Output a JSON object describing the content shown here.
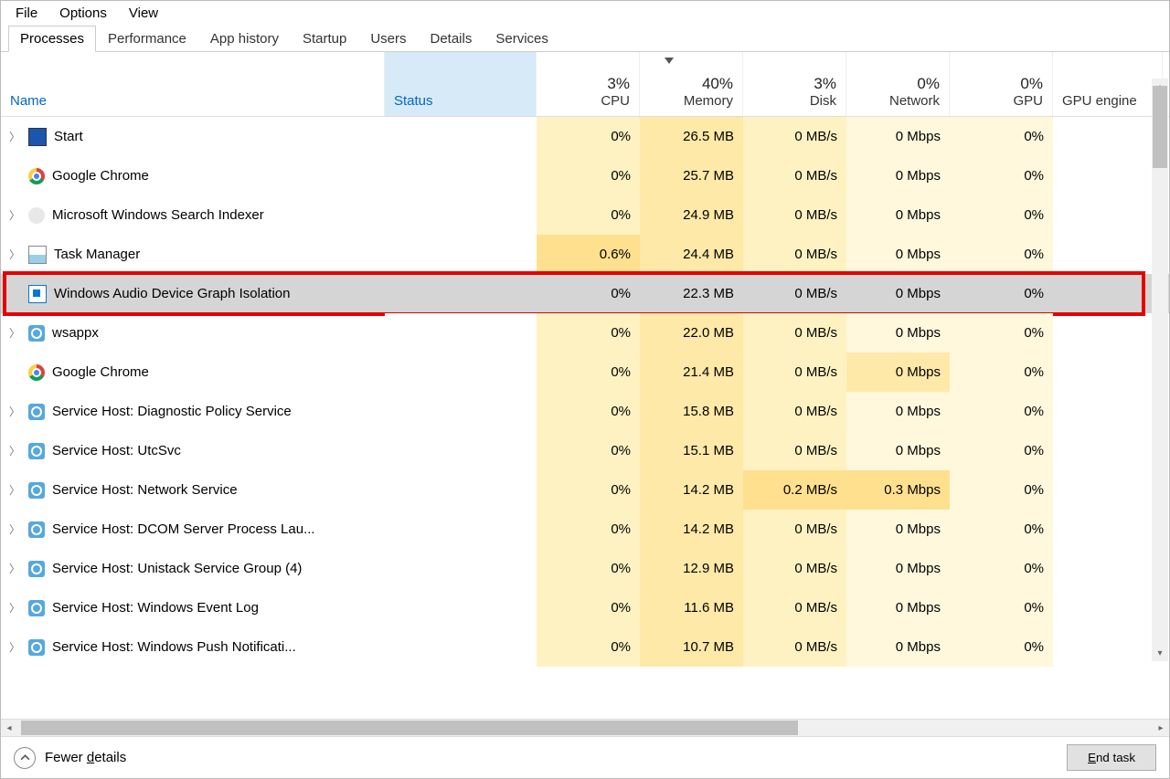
{
  "menu": {
    "file": "File",
    "options": "Options",
    "view": "View"
  },
  "tabs": [
    "Processes",
    "Performance",
    "App history",
    "Startup",
    "Users",
    "Details",
    "Services"
  ],
  "activeTab": "Processes",
  "columns": {
    "name": "Name",
    "status": "Status",
    "cpu": {
      "top": "3%",
      "bot": "CPU"
    },
    "mem": {
      "top": "40%",
      "bot": "Memory"
    },
    "disk": {
      "top": "3%",
      "bot": "Disk"
    },
    "net": {
      "top": "0%",
      "bot": "Network"
    },
    "gpu": {
      "top": "0%",
      "bot": "GPU"
    },
    "gpue": "GPU engine"
  },
  "rows": [
    {
      "exp": true,
      "icon": "start",
      "name": "Start",
      "cpu": "0%",
      "mem": "26.5 MB",
      "disk": "0 MB/s",
      "net": "0 Mbps",
      "gpu": "0%",
      "heat": {
        "cpu": "h1",
        "mem": "h2",
        "disk": "h1",
        "net": "h0",
        "gpu": "h0"
      }
    },
    {
      "exp": false,
      "icon": "chrome",
      "name": "Google Chrome",
      "cpu": "0%",
      "mem": "25.7 MB",
      "disk": "0 MB/s",
      "net": "0 Mbps",
      "gpu": "0%",
      "heat": {
        "cpu": "h1",
        "mem": "h2",
        "disk": "h1",
        "net": "h0",
        "gpu": "h0"
      }
    },
    {
      "exp": true,
      "icon": "search",
      "name": "Microsoft Windows Search Indexer",
      "cpu": "0%",
      "mem": "24.9 MB",
      "disk": "0 MB/s",
      "net": "0 Mbps",
      "gpu": "0%",
      "heat": {
        "cpu": "h1",
        "mem": "h2",
        "disk": "h1",
        "net": "h0",
        "gpu": "h0"
      }
    },
    {
      "exp": true,
      "icon": "tm",
      "name": "Task Manager",
      "cpu": "0.6%",
      "mem": "24.4 MB",
      "disk": "0 MB/s",
      "net": "0 Mbps",
      "gpu": "0%",
      "heat": {
        "cpu": "h3",
        "mem": "h2",
        "disk": "h1",
        "net": "h0",
        "gpu": "h0"
      }
    },
    {
      "exp": false,
      "icon": "win",
      "name": "Windows Audio Device Graph Isolation",
      "cpu": "0%",
      "mem": "22.3 MB",
      "disk": "0 MB/s",
      "net": "0 Mbps",
      "gpu": "0%",
      "selected": true,
      "highlight": true
    },
    {
      "exp": true,
      "icon": "gear",
      "name": "wsappx",
      "cpu": "0%",
      "mem": "22.0 MB",
      "disk": "0 MB/s",
      "net": "0 Mbps",
      "gpu": "0%",
      "heat": {
        "cpu": "h1",
        "mem": "h2",
        "disk": "h1",
        "net": "h0",
        "gpu": "h0"
      }
    },
    {
      "exp": false,
      "icon": "chrome",
      "name": "Google Chrome",
      "cpu": "0%",
      "mem": "21.4 MB",
      "disk": "0 MB/s",
      "net": "0 Mbps",
      "gpu": "0%",
      "heat": {
        "cpu": "h1",
        "mem": "h2",
        "disk": "h1",
        "net": "h2",
        "gpu": "h0"
      }
    },
    {
      "exp": true,
      "icon": "gear",
      "name": "Service Host: Diagnostic Policy Service",
      "cpu": "0%",
      "mem": "15.8 MB",
      "disk": "0 MB/s",
      "net": "0 Mbps",
      "gpu": "0%",
      "heat": {
        "cpu": "h1",
        "mem": "h2",
        "disk": "h1",
        "net": "h0",
        "gpu": "h0"
      }
    },
    {
      "exp": true,
      "icon": "gear",
      "name": "Service Host: UtcSvc",
      "cpu": "0%",
      "mem": "15.1 MB",
      "disk": "0 MB/s",
      "net": "0 Mbps",
      "gpu": "0%",
      "heat": {
        "cpu": "h1",
        "mem": "h2",
        "disk": "h1",
        "net": "h0",
        "gpu": "h0"
      }
    },
    {
      "exp": true,
      "icon": "gear",
      "name": "Service Host: Network Service",
      "cpu": "0%",
      "mem": "14.2 MB",
      "disk": "0.2 MB/s",
      "net": "0.3 Mbps",
      "gpu": "0%",
      "heat": {
        "cpu": "h1",
        "mem": "h2",
        "disk": "h3",
        "net": "h3",
        "gpu": "h0"
      }
    },
    {
      "exp": true,
      "icon": "gear",
      "name": "Service Host: DCOM Server Process Lau...",
      "cpu": "0%",
      "mem": "14.2 MB",
      "disk": "0 MB/s",
      "net": "0 Mbps",
      "gpu": "0%",
      "heat": {
        "cpu": "h1",
        "mem": "h2",
        "disk": "h1",
        "net": "h0",
        "gpu": "h0"
      }
    },
    {
      "exp": true,
      "icon": "gear",
      "name": "Service Host: Unistack Service Group (4)",
      "cpu": "0%",
      "mem": "12.9 MB",
      "disk": "0 MB/s",
      "net": "0 Mbps",
      "gpu": "0%",
      "heat": {
        "cpu": "h1",
        "mem": "h2",
        "disk": "h1",
        "net": "h0",
        "gpu": "h0"
      }
    },
    {
      "exp": true,
      "icon": "gear",
      "name": "Service Host: Windows Event Log",
      "cpu": "0%",
      "mem": "11.6 MB",
      "disk": "0 MB/s",
      "net": "0 Mbps",
      "gpu": "0%",
      "heat": {
        "cpu": "h1",
        "mem": "h2",
        "disk": "h1",
        "net": "h0",
        "gpu": "h0"
      }
    },
    {
      "exp": true,
      "icon": "gear",
      "name": "Service Host: Windows Push Notificati...",
      "cpu": "0%",
      "mem": "10.7 MB",
      "disk": "0 MB/s",
      "net": "0 Mbps",
      "gpu": "0%",
      "heat": {
        "cpu": "h1",
        "mem": "h2",
        "disk": "h1",
        "net": "h0",
        "gpu": "h0"
      }
    }
  ],
  "footer": {
    "fewer": "Fewer details",
    "fewer_ul": "d",
    "endtask_pre": "",
    "endtask_ul": "E",
    "endtask_post": "nd task"
  }
}
